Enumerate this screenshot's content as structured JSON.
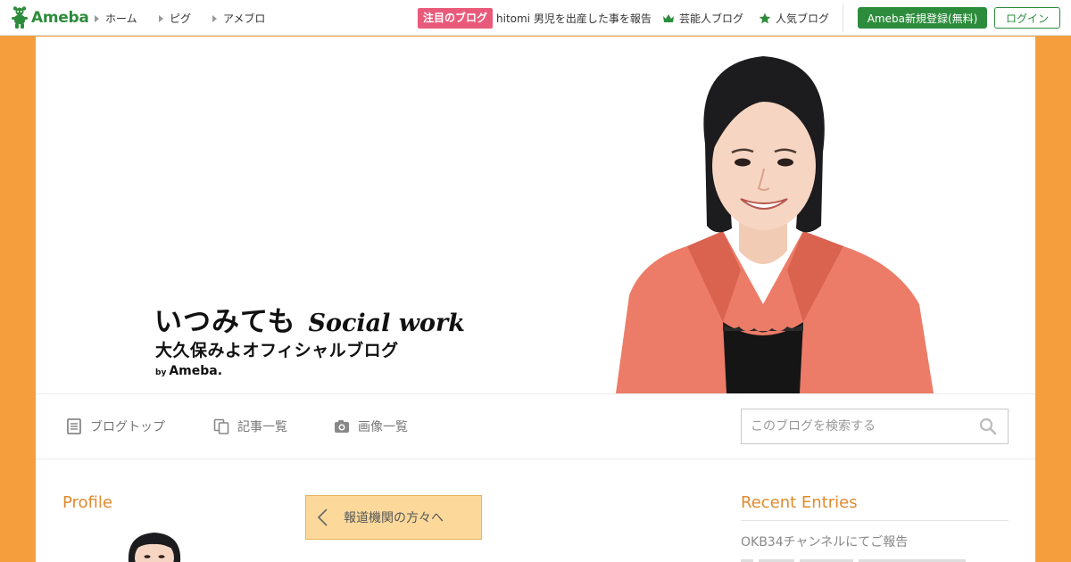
{
  "topbar": {
    "logo_text": "Ameba",
    "nav": [
      {
        "label": "ホーム"
      },
      {
        "label": "ピグ"
      },
      {
        "label": "アメブロ"
      }
    ],
    "featured_badge": "注目のブログ",
    "featured_text": "hitomi 男児を出産した事を報告",
    "rankings": [
      {
        "label": "芸能人ブログ",
        "icon": "crown-icon"
      },
      {
        "label": "人気ブログ",
        "icon": "star-icon"
      }
    ],
    "register_label": "Ameba新規登録(無料)",
    "login_label": "ログイン"
  },
  "banner": {
    "title_jp": "いつみても",
    "title_en": "Social work",
    "subtitle": "大久保みよオフィシャルブログ",
    "by_small": "by",
    "by_brand": "Ameba."
  },
  "blognav": {
    "items": [
      {
        "label": "ブログトップ",
        "icon": "document-icon"
      },
      {
        "label": "記事一覧",
        "icon": "copy-icon"
      },
      {
        "label": "画像一覧",
        "icon": "camera-icon"
      }
    ],
    "search_placeholder": "このブログを検索する"
  },
  "sidebar": {
    "profile_heading": "Profile"
  },
  "main_content": {
    "press_button": "報道機関の方々へ"
  },
  "recent": {
    "heading": "Recent Entries",
    "entries": [
      {
        "title": "OKB34チャンネルにてご報告"
      }
    ]
  },
  "colors": {
    "page_background": "#f49e3e",
    "ameba_green": "#2d8c3c",
    "featured_pink": "#e95a7a",
    "heading_orange": "#e08a2e",
    "press_button_fill": "#fcd99b"
  }
}
